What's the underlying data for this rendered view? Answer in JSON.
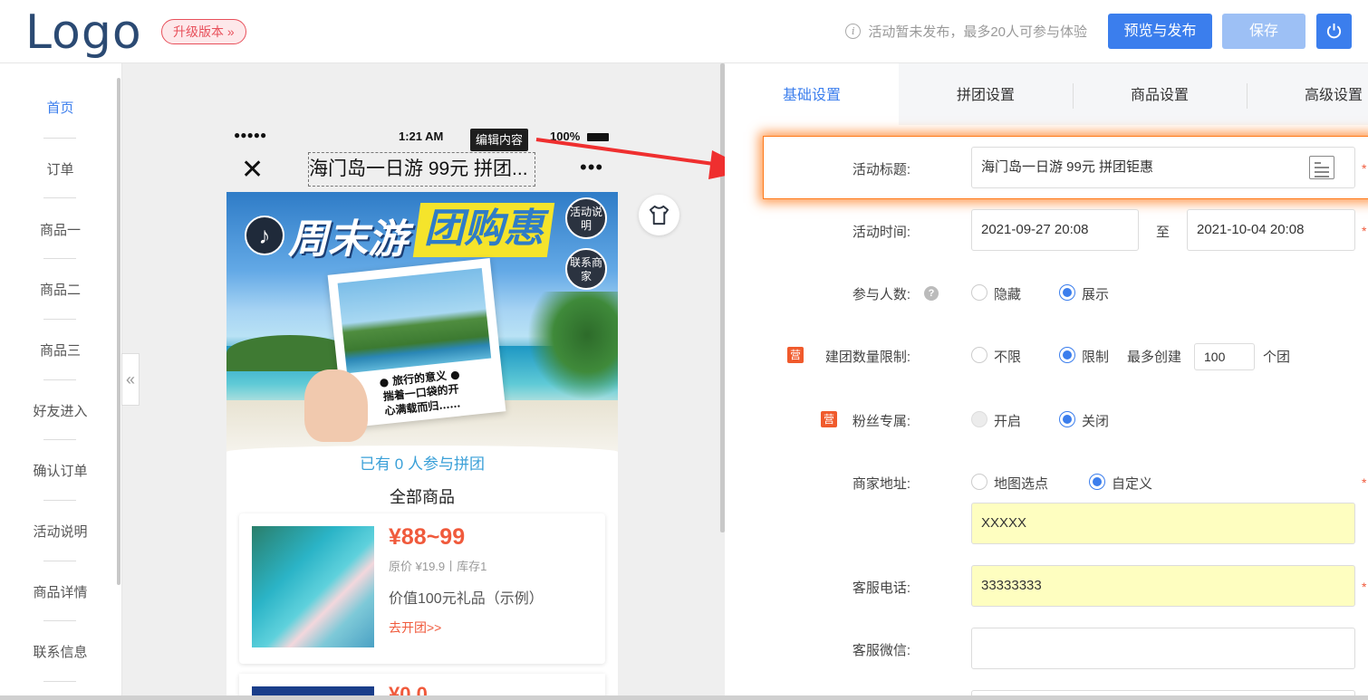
{
  "header": {
    "logo": "Logo",
    "upgrade_label": "升级版本 »",
    "notice_icon": "i",
    "notice": "活动暂未发布，最多20人可参与体验",
    "publish_label": "预览与发布",
    "save_label": "保存",
    "power_icon": "power-icon"
  },
  "sidebar": {
    "items": [
      {
        "label": "首页",
        "active": true
      },
      {
        "label": "订单"
      },
      {
        "label": "商品一"
      },
      {
        "label": "商品二"
      },
      {
        "label": "商品三"
      },
      {
        "label": "好友进入"
      },
      {
        "label": "确认订单"
      },
      {
        "label": "活动说明"
      },
      {
        "label": "商品详情"
      },
      {
        "label": "联系信息"
      }
    ],
    "collapse_glyph": "«"
  },
  "phone": {
    "status": {
      "dots": "●●●●●",
      "time": "1:21 AM",
      "battery": "100%"
    },
    "close_glyph": "✕",
    "title": "海门岛一日游 99元 拼团...",
    "more_glyph": "•••",
    "banner": {
      "headline1": "周末游",
      "headline2": "团购惠",
      "music_glyph": "♪",
      "badge1": "活动说明",
      "badge2": "联系商家",
      "caption_line1": "● 旅行的意义 ●",
      "caption_line2": "揣着一口袋的开",
      "caption_line3": "心满载而归……"
    },
    "joined": "已有 0 人参与拼团",
    "all_goods": "全部商品",
    "goods": [
      {
        "price": "¥88~99",
        "orig": "原价 ¥19.9丨库存1",
        "desc": "价值100元礼品（示例）",
        "link": "去开团>>"
      },
      {
        "price": "¥0.0"
      }
    ],
    "edit_tip": "编辑内容"
  },
  "tabs": [
    {
      "label": "基础设置",
      "active": true
    },
    {
      "label": "拼团设置"
    },
    {
      "label": "商品设置"
    },
    {
      "label": "高级设置"
    }
  ],
  "form": {
    "title": {
      "label": "活动标题:",
      "value": "海门岛一日游 99元 拼团钜惠"
    },
    "time": {
      "label": "活动时间:",
      "start": "2021-09-27 20:08",
      "sep": "至",
      "end": "2021-10-04 20:08"
    },
    "participants": {
      "label": "参与人数:",
      "help": "?",
      "options": [
        "隐藏",
        "展示"
      ],
      "selected": "展示"
    },
    "group_limit": {
      "tag": "营",
      "label": "建团数量限制:",
      "options": [
        "不限",
        "限制"
      ],
      "selected": "限制",
      "prefix": "最多创建",
      "value": "100",
      "suffix": "个团"
    },
    "fans_only": {
      "tag": "营",
      "label": "粉丝专属:",
      "options": [
        "开启",
        "关闭"
      ],
      "selected": "关闭"
    },
    "address": {
      "label": "商家地址:",
      "options": [
        "地图选点",
        "自定义"
      ],
      "selected": "自定义",
      "value": "XXXXX"
    },
    "phone": {
      "label": "客服电话:",
      "value": "33333333"
    },
    "wechat": {
      "label": "客服微信:",
      "value": ""
    },
    "required_mark": "*"
  },
  "colors": {
    "accent": "#3b7eed",
    "price": "#f05a3c",
    "highlight": "#ff7a1a"
  }
}
